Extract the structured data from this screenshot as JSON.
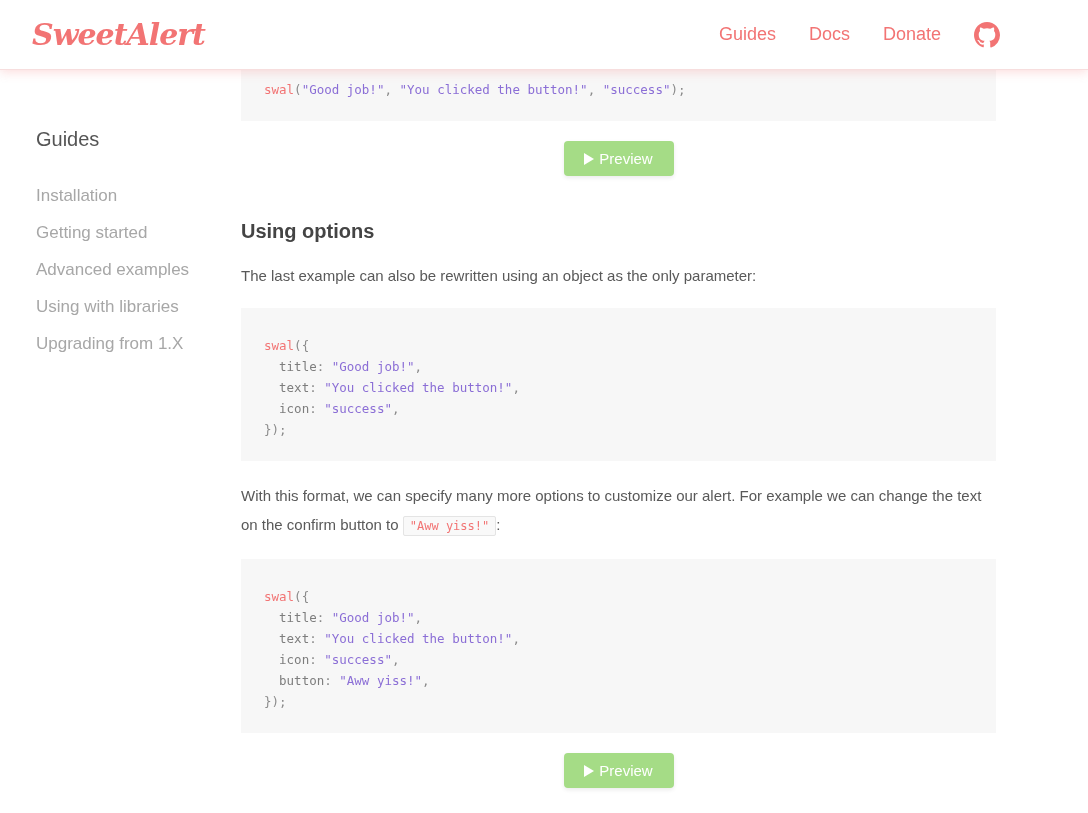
{
  "header": {
    "logo": "SweetAlert",
    "nav": [
      {
        "label": "Guides"
      },
      {
        "label": "Docs"
      },
      {
        "label": "Donate"
      }
    ]
  },
  "sidebar": {
    "title": "Guides",
    "items": [
      {
        "label": "Installation"
      },
      {
        "label": "Getting started"
      },
      {
        "label": "Advanced examples"
      },
      {
        "label": "Using with libraries"
      },
      {
        "label": "Upgrading from 1.X"
      }
    ]
  },
  "content": [
    {
      "kind": "code",
      "lines": [
        [
          {
            "kind": "fn",
            "text": "swal"
          },
          {
            "kind": "punct",
            "text": "("
          },
          {
            "kind": "string",
            "text": "\"Good job!\""
          },
          {
            "kind": "punct",
            "text": ", "
          },
          {
            "kind": "string",
            "text": "\"You clicked the button!\""
          },
          {
            "kind": "punct",
            "text": ", "
          },
          {
            "kind": "string",
            "text": "\"success\""
          },
          {
            "kind": "punct",
            "text": ");"
          }
        ]
      ]
    },
    {
      "kind": "button",
      "label": "Preview"
    },
    {
      "kind": "heading",
      "text": "Using options"
    },
    {
      "kind": "paragraph",
      "parts": [
        {
          "kind": "text",
          "text": "The last example can also be rewritten using an object as the only parameter:"
        }
      ]
    },
    {
      "kind": "code",
      "lines": [
        [
          {
            "kind": "fn",
            "text": "swal"
          },
          {
            "kind": "punct",
            "text": "({"
          }
        ],
        [
          {
            "kind": "key",
            "text": "  title"
          },
          {
            "kind": "punct",
            "text": ": "
          },
          {
            "kind": "string",
            "text": "\"Good job!\""
          },
          {
            "kind": "punct",
            "text": ","
          }
        ],
        [
          {
            "kind": "key",
            "text": "  text"
          },
          {
            "kind": "punct",
            "text": ": "
          },
          {
            "kind": "string",
            "text": "\"You clicked the button!\""
          },
          {
            "kind": "punct",
            "text": ","
          }
        ],
        [
          {
            "kind": "key",
            "text": "  icon"
          },
          {
            "kind": "punct",
            "text": ": "
          },
          {
            "kind": "string",
            "text": "\"success\""
          },
          {
            "kind": "punct",
            "text": ","
          }
        ],
        [
          {
            "kind": "punct",
            "text": "});"
          }
        ]
      ]
    },
    {
      "kind": "paragraph",
      "parts": [
        {
          "kind": "text",
          "text": "With this format, we can specify many more options to customize our alert. For example we can change the text on the confirm button to "
        },
        {
          "kind": "code",
          "text": "\"Aww yiss!\""
        },
        {
          "kind": "text",
          "text": ":"
        }
      ]
    },
    {
      "kind": "code",
      "lines": [
        [
          {
            "kind": "fn",
            "text": "swal"
          },
          {
            "kind": "punct",
            "text": "({"
          }
        ],
        [
          {
            "kind": "key",
            "text": "  title"
          },
          {
            "kind": "punct",
            "text": ": "
          },
          {
            "kind": "string",
            "text": "\"Good job!\""
          },
          {
            "kind": "punct",
            "text": ","
          }
        ],
        [
          {
            "kind": "key",
            "text": "  text"
          },
          {
            "kind": "punct",
            "text": ": "
          },
          {
            "kind": "string",
            "text": "\"You clicked the button!\""
          },
          {
            "kind": "punct",
            "text": ","
          }
        ],
        [
          {
            "kind": "key",
            "text": "  icon"
          },
          {
            "kind": "punct",
            "text": ": "
          },
          {
            "kind": "string",
            "text": "\"success\""
          },
          {
            "kind": "punct",
            "text": ","
          }
        ],
        [
          {
            "kind": "key",
            "text": "  button"
          },
          {
            "kind": "punct",
            "text": ": "
          },
          {
            "kind": "string",
            "text": "\"Aww yiss!\""
          },
          {
            "kind": "punct",
            "text": ","
          }
        ],
        [
          {
            "kind": "punct",
            "text": "});"
          }
        ]
      ]
    },
    {
      "kind": "button",
      "label": "Preview"
    }
  ]
}
